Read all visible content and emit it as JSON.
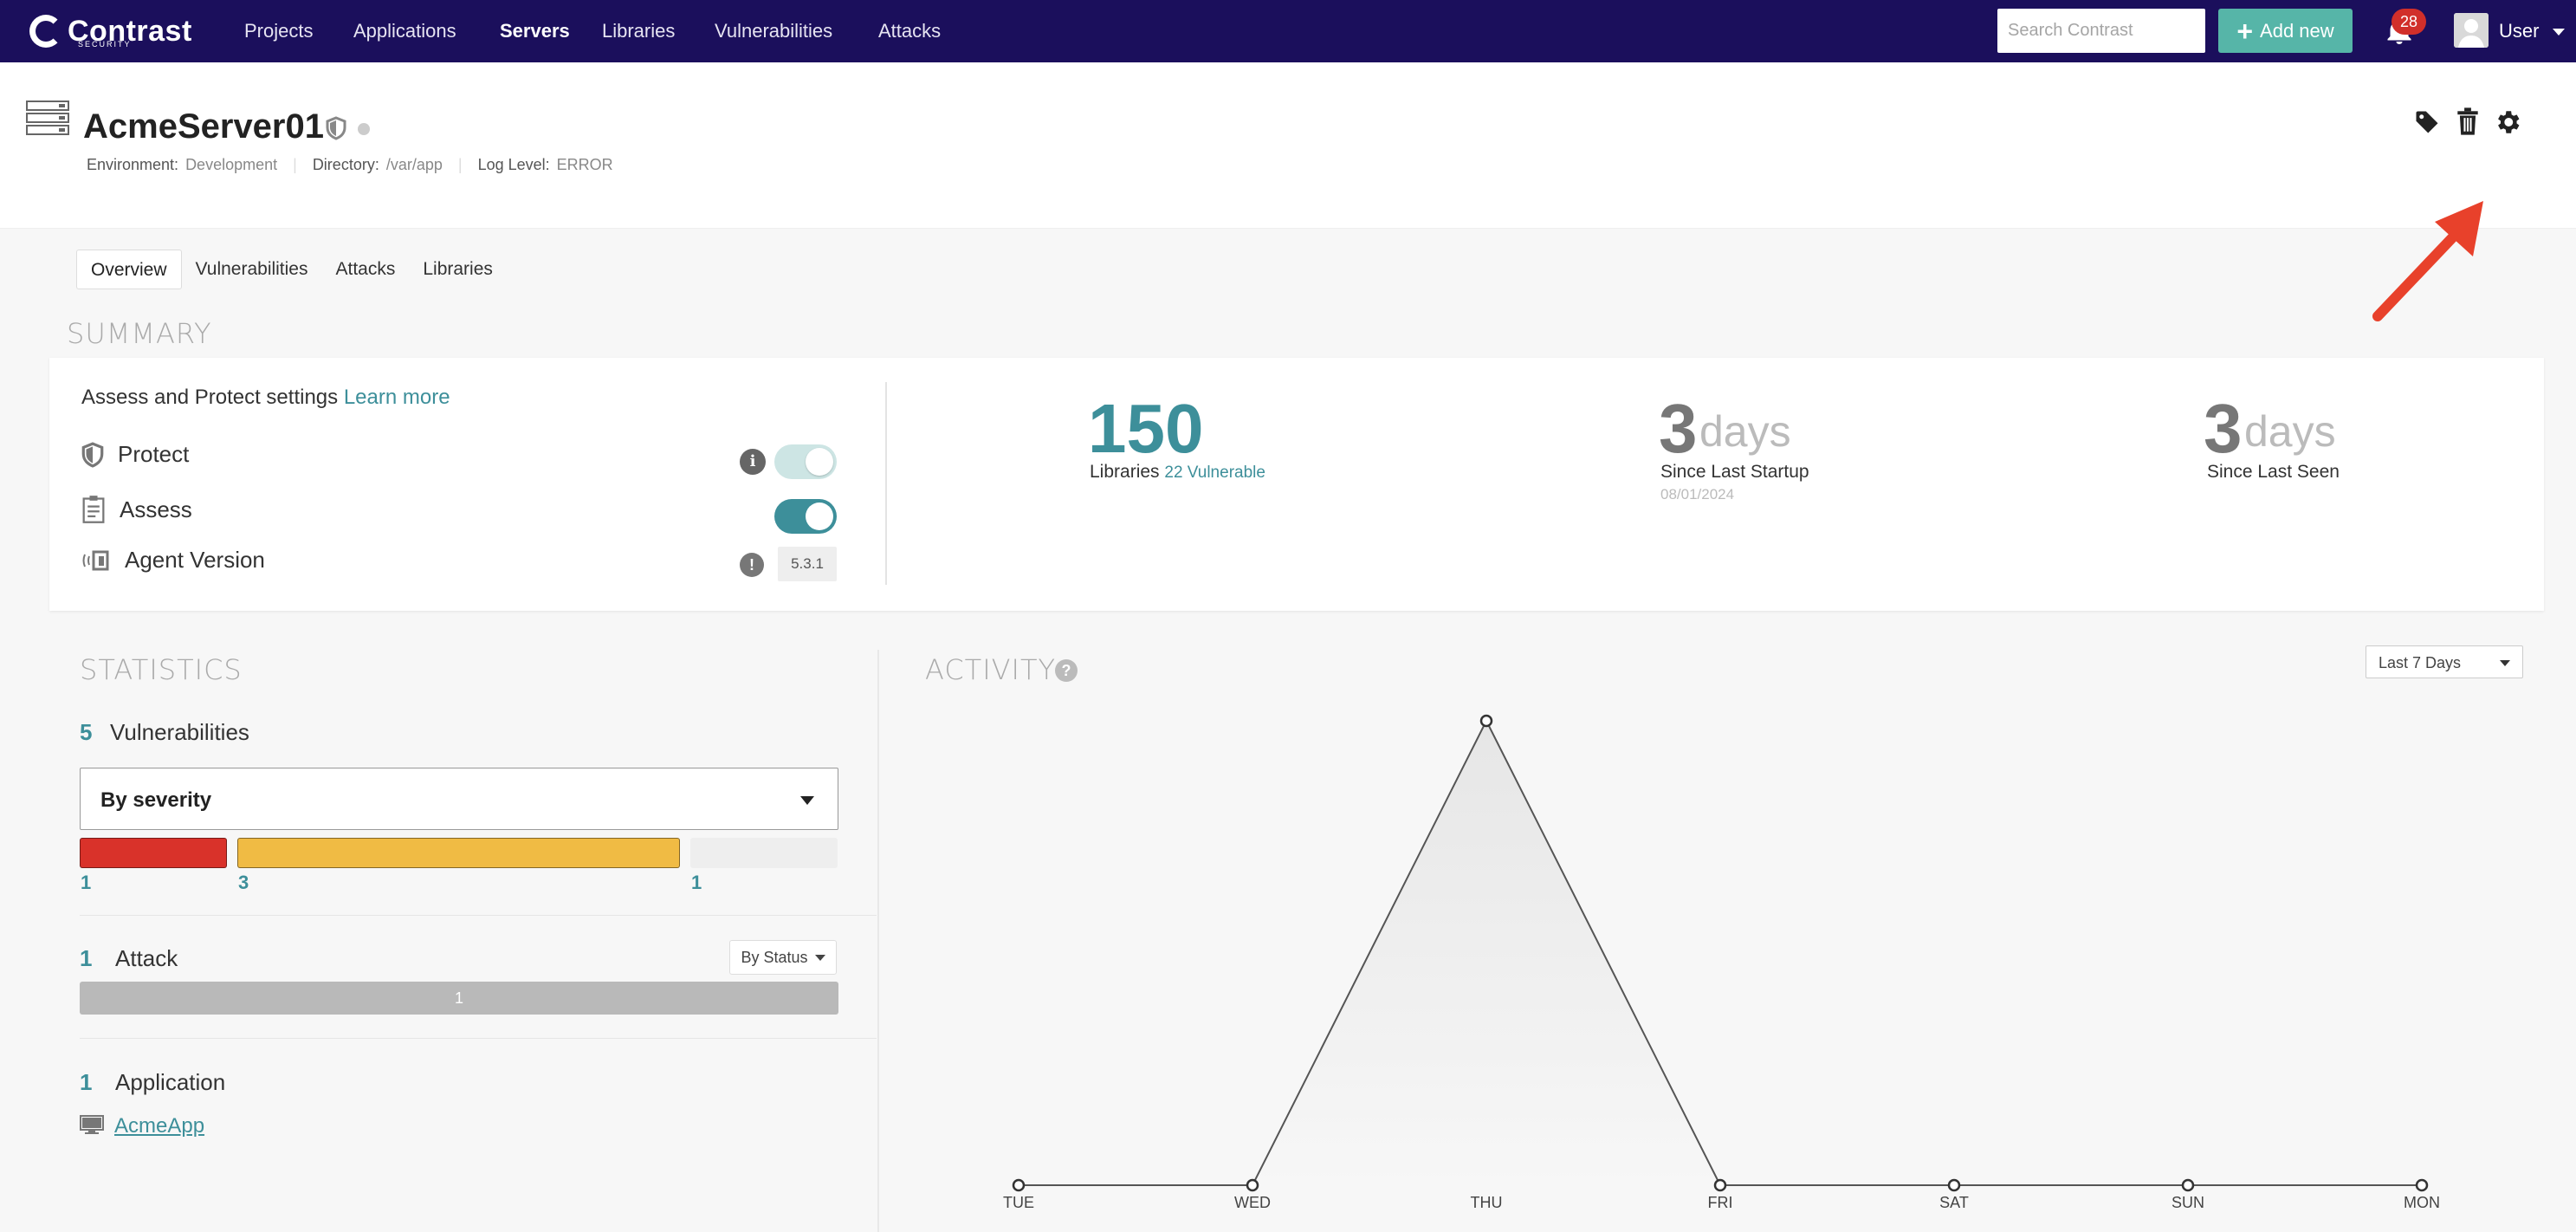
{
  "nav": {
    "brand": "Contrast",
    "brand_sub": "SECURITY",
    "items": [
      "Projects",
      "Applications",
      "Servers",
      "Libraries",
      "Vulnerabilities",
      "Attacks"
    ],
    "active": "Servers",
    "search_placeholder": "Search Contrast",
    "add_new": "Add new",
    "notification_count": "28",
    "user": "User"
  },
  "server": {
    "name": "AcmeServer01",
    "environment_key": "Environment:",
    "environment": "Development",
    "directory_key": "Directory:",
    "directory": "/var/app",
    "log_level_key": "Log Level:",
    "log_level": "ERROR"
  },
  "tabs": [
    "Overview",
    "Vulnerabilities",
    "Attacks",
    "Libraries"
  ],
  "summary": {
    "title": "SUMMARY",
    "settings_title": "Assess and Protect settings",
    "learn_more": "Learn more",
    "protect_label": "Protect",
    "protect_on": true,
    "assess_label": "Assess",
    "assess_on": true,
    "agent_label": "Agent Version",
    "agent_version": "5.3.1",
    "libraries_count": "150",
    "libraries_label": "Libraries",
    "libraries_vulnerable": "22 Vulnerable",
    "startup_days": "3",
    "startup_unit": "days",
    "startup_label": "Since Last Startup",
    "startup_date": "08/01/2024",
    "seen_days": "3",
    "seen_unit": "days",
    "seen_label": "Since Last Seen"
  },
  "statistics": {
    "title": "STATISTICS",
    "vuln_count": "5",
    "vuln_label": "Vulnerabilities",
    "severity_select": "By severity",
    "severity": [
      {
        "value": 1,
        "label": "1",
        "color": "#d9322a"
      },
      {
        "value": 3,
        "label": "3",
        "color": "#f0bb44"
      },
      {
        "value": 1,
        "label": "1",
        "color": "#eeeeee"
      }
    ],
    "attack_count": "1",
    "attack_label": "Attack",
    "attack_select": "By Status",
    "attack_bar_value": "1",
    "app_count": "1",
    "app_label": "Application",
    "app_name": "AcmeApp"
  },
  "activity": {
    "title": "ACTIVITY",
    "range": "Last 7 Days"
  },
  "chart_data": {
    "type": "area",
    "categories": [
      "TUE",
      "WED",
      "THU",
      "FRI",
      "SAT",
      "SUN",
      "MON"
    ],
    "values": [
      0,
      0,
      1,
      0,
      0,
      0,
      0
    ],
    "ylim": [
      0,
      1
    ]
  },
  "colors": {
    "nav_bg": "#1b0f5c",
    "accent": "#3d8f9a",
    "add_button": "#56b5a8",
    "badge": "#d12f2a",
    "arrow": "#e8412b"
  },
  "icons": [
    "server-icon",
    "shield-icon",
    "tag-icon",
    "trash-icon",
    "gear-icon",
    "bell-icon",
    "info-icon",
    "clipboard-icon",
    "agent-icon",
    "monitor-icon",
    "help-icon",
    "chevron-down-icon"
  ]
}
